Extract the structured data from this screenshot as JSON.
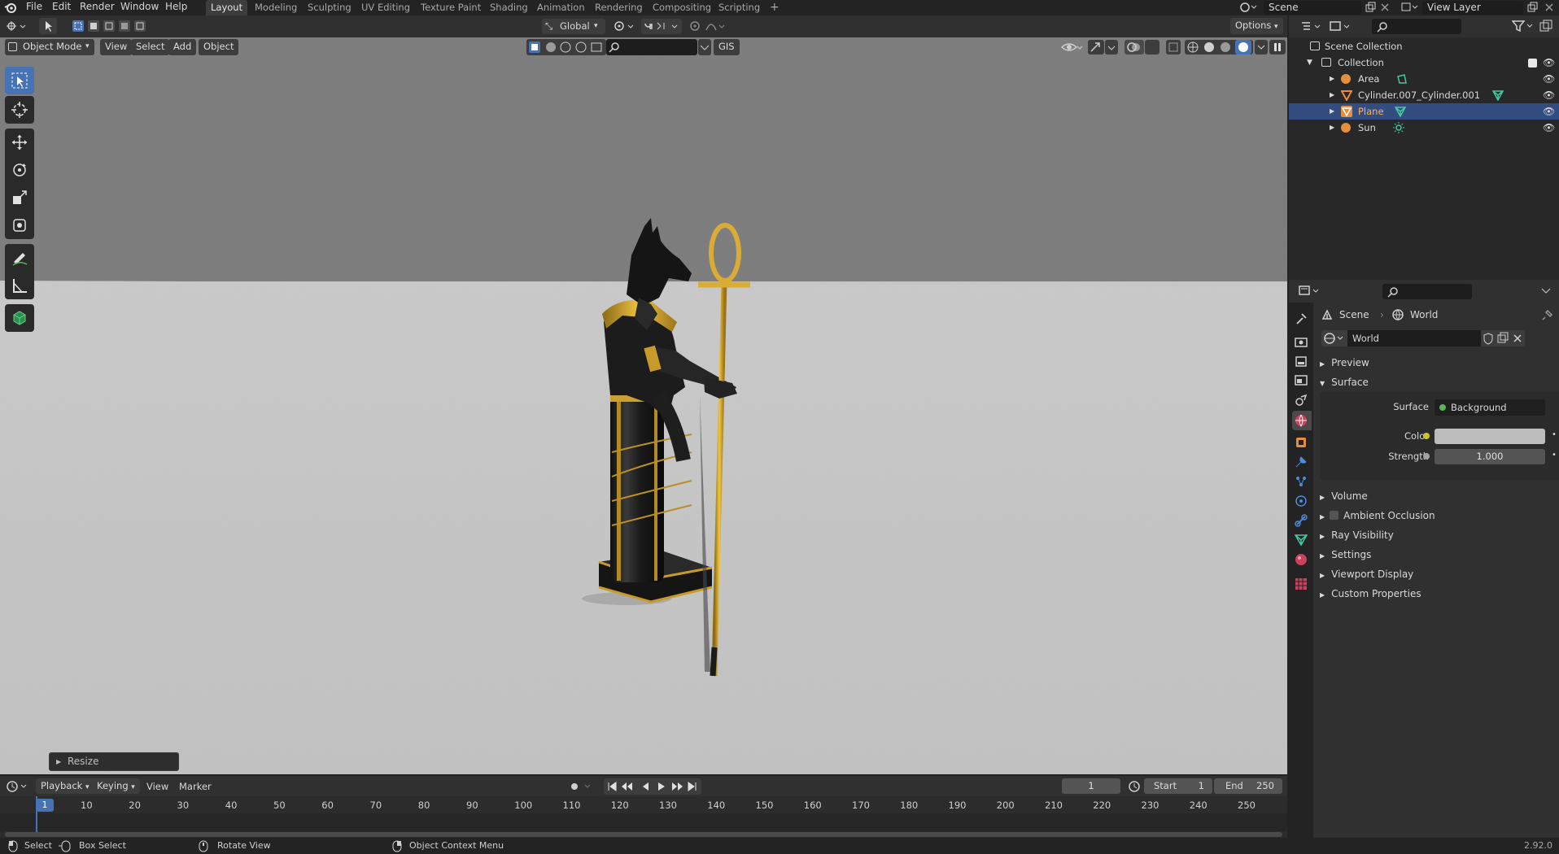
{
  "menu": {
    "file": "File",
    "edit": "Edit",
    "render": "Render",
    "window": "Window",
    "help": "Help"
  },
  "workspaces": [
    "Layout",
    "Modeling",
    "Sculpting",
    "UV Editing",
    "Texture Paint",
    "Shading",
    "Animation",
    "Rendering",
    "Compositing",
    "Scripting"
  ],
  "add_workspace": "+",
  "scene_field": "Scene",
  "view_layer_field": "View Layer",
  "viewport": {
    "mode": "Object Mode",
    "view_menu": "View",
    "select_menu": "Select",
    "add_menu": "Add",
    "object_menu": "Object",
    "orientation": "Global",
    "options": "Options",
    "gis": "GIS",
    "last_op": "Resize"
  },
  "outliner": {
    "root": "Scene Collection",
    "collection": "Collection",
    "items": [
      {
        "name": "Area"
      },
      {
        "name": "Cylinder.007_Cylinder.001"
      },
      {
        "name": "Plane"
      },
      {
        "name": "Sun"
      }
    ]
  },
  "properties": {
    "breadcrumb_scene": "Scene",
    "breadcrumb_world": "World",
    "world_name": "World",
    "panels": {
      "preview": "Preview",
      "surface": "Surface",
      "volume": "Volume",
      "ao": "Ambient Occlusion",
      "ray_visibility": "Ray Visibility",
      "settings": "Settings",
      "viewport_display": "Viewport Display",
      "custom_properties": "Custom Properties"
    },
    "surface_label": "Surface",
    "surface_value": "Background",
    "color_label": "Color",
    "strength_label": "Strength",
    "strength_value": "1.000",
    "color_value": "#bcbcbc"
  },
  "timeline": {
    "playback": "Playback",
    "keying": "Keying",
    "view": "View",
    "marker": "Marker",
    "current_frame": "1",
    "start_label": "Start",
    "start_value": "1",
    "end_label": "End",
    "end_value": "250",
    "playhead": "1",
    "ruler": [
      "10",
      "20",
      "30",
      "40",
      "50",
      "60",
      "70",
      "80",
      "90",
      "100",
      "110",
      "120",
      "130",
      "140",
      "150",
      "160",
      "170",
      "180",
      "190",
      "200",
      "210",
      "220",
      "230",
      "240",
      "250"
    ]
  },
  "status": {
    "select": "Select",
    "box_select": "Box Select",
    "rotate_view": "Rotate View",
    "context_menu": "Object Context Menu",
    "version": "2.92.0"
  },
  "colors": {
    "accent": "#4772b3",
    "selected_row": "#334d80",
    "gold": "#d4a72c"
  }
}
